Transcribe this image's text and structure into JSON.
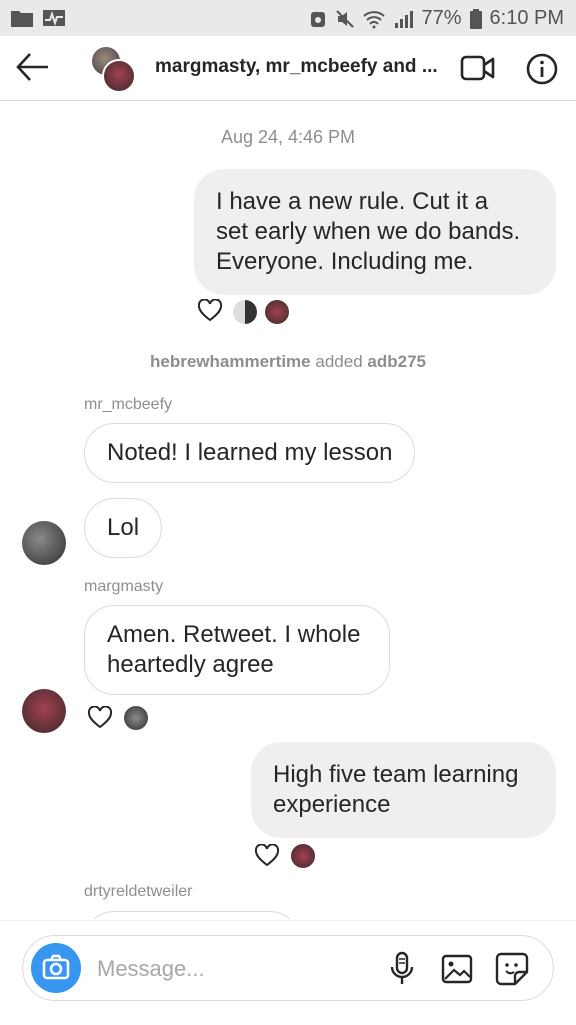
{
  "status_bar": {
    "battery": "77%",
    "time": "6:10 PM"
  },
  "header": {
    "title": "margmasty, mr_mcbeefy and ..."
  },
  "thread": {
    "timestamp": "Aug 24, 4:46 PM",
    "messages": [
      {
        "sender": "",
        "text_lines": [
          "I have a new rule. Cut it a",
          "set early when we do bands.",
          "Everyone. Including me."
        ]
      },
      {
        "sender": "mr_mcbeefy",
        "text": "Noted! I learned my lesson"
      },
      {
        "sender": "",
        "text": "Lol"
      },
      {
        "sender": "margmasty",
        "text_lines": [
          "Amen. Retweet. I whole",
          "heartedly agree"
        ]
      },
      {
        "sender": "",
        "text_lines": [
          "High five team learning",
          "experience"
        ]
      },
      {
        "sender": "drtyreldetweiler",
        "text": ""
      }
    ],
    "system_event": {
      "actor": "hebrewhammertime",
      "action": "added",
      "target": "adb275"
    }
  },
  "composer": {
    "placeholder": "Message..."
  },
  "icons": {
    "back": "back-arrow-icon",
    "video": "video-call-icon",
    "info": "info-icon",
    "camera": "camera-icon",
    "mic": "microphone-icon",
    "gallery": "gallery-icon",
    "sticker": "sticker-icon",
    "heart": "heart-icon"
  },
  "colors": {
    "accent": "#3797f0",
    "bubble_out": "#efefef",
    "border": "#dbdbdb",
    "meta_text": "#8e8e8e"
  }
}
